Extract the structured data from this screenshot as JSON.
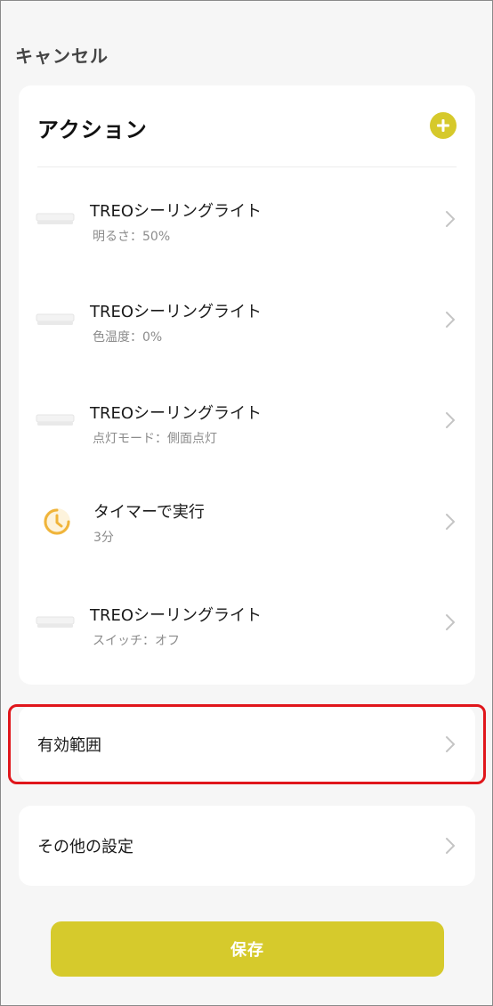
{
  "header": {
    "cancel_label": "キャンセル"
  },
  "actions": {
    "title": "アクション",
    "add_icon": "plus-circle-icon",
    "items": [
      {
        "title": "TREOシーリングライト",
        "subtitle": "明るさ：50%",
        "icon": "ceiling-light-icon"
      },
      {
        "title": "TREOシーリングライト",
        "subtitle": "色温度：0%",
        "icon": "ceiling-light-icon"
      },
      {
        "title": "TREOシーリングライト",
        "subtitle": "点灯モード：側面点灯",
        "icon": "ceiling-light-icon"
      },
      {
        "title": "タイマーで実行",
        "subtitle": "3分",
        "icon": "timer-icon"
      },
      {
        "title": "TREOシーリングライト",
        "subtitle": "スイッチ：オフ",
        "icon": "ceiling-light-icon"
      }
    ]
  },
  "range": {
    "label": "有効範囲"
  },
  "other": {
    "label": "その他の設定"
  },
  "footer": {
    "save_label": "保存"
  },
  "colors": {
    "accent": "#d6ca2c",
    "highlight": "#e0161b",
    "timer": "#f0b43a"
  }
}
